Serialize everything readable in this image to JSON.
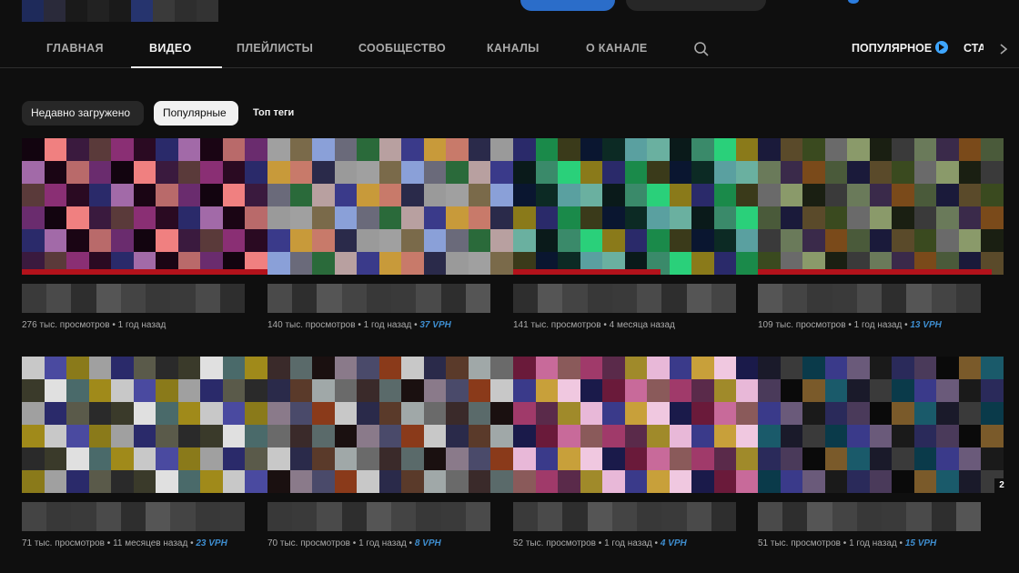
{
  "tabs": [
    {
      "label": "ГЛАВНАЯ",
      "active": false
    },
    {
      "label": "ВИДЕО",
      "active": true
    },
    {
      "label": "ПЛЕЙЛИСТЫ",
      "active": false
    },
    {
      "label": "СООБЩЕСТВО",
      "active": false
    },
    {
      "label": "КАНАЛЫ",
      "active": false
    },
    {
      "label": "О КАНАЛЕ",
      "active": false
    }
  ],
  "tabs_right": {
    "popular_label": "ПОПУЛЯРНОЕ",
    "cut_label": "СТА"
  },
  "chips": {
    "recent": "Недавно загружено",
    "popular": "Популярные",
    "top_tags": "Топ теги"
  },
  "colors": {
    "accent": "#3ea6ff",
    "vph": "#3e8ed0",
    "progress": "#b3121b",
    "subscribe": "#2b6dc9"
  },
  "videos": [
    {
      "views": "276 тыс. просмотров",
      "age": "1 год назад",
      "vph": "",
      "watched": 1.0,
      "palette": [
        "#12040f",
        "#1a0514",
        "#2a0a22",
        "#3a1a3e",
        "#6a2c6e",
        "#a26aa8",
        "#8a2f74",
        "#f08080",
        "#b96a6a",
        "#2a2a6a",
        "#5a3a3a"
      ]
    },
    {
      "views": "140 тыс. просмотров",
      "age": "1 год назад",
      "vph": "37 VPH",
      "watched": 0.0,
      "palette": [
        "#2a2a4a",
        "#3a3a8a",
        "#6a6a7a",
        "#a0a0a0",
        "#c87a6a",
        "#b8a0a0",
        "#8aa0d8",
        "#9a9a9a",
        "#c89a3a",
        "#2a6a3a",
        "#7a6a4a"
      ]
    },
    {
      "views": "141 тыс. просмотров",
      "age": "4 месяца назад",
      "vph": "",
      "watched": 0.6,
      "palette": [
        "#0a1a1a",
        "#0c2a24",
        "#1a8a4a",
        "#2ad07a",
        "#6ab0a0",
        "#0a1630",
        "#2a2a6a",
        "#3a8a6a",
        "#5aa0a0",
        "#3a3a1a",
        "#8a7a1a"
      ]
    },
    {
      "views": "109 тыс. просмотров",
      "age": "1 год назад",
      "vph": "13 VPH",
      "watched": 0.95,
      "palette": [
        "#1a1f12",
        "#3a4a1f",
        "#4a5a3a",
        "#6a7a5a",
        "#8a9a6a",
        "#5a4a2a",
        "#7a4a1a",
        "#3a3a3a",
        "#6a6a6a",
        "#1a1a3a",
        "#3a2a4a"
      ]
    },
    {
      "views": "71 тыс. просмотров",
      "age": "11 месяцев назад",
      "vph": "23 VPH",
      "watched": 0.0,
      "palette": [
        "#a0a0a0",
        "#c8c8c8",
        "#e0e0e0",
        "#5a5a4a",
        "#8a7a1a",
        "#a08a1a",
        "#3a3a2a",
        "#2a2a6a",
        "#4a4aa0",
        "#4a6a6a",
        "#2a2a2a"
      ]
    },
    {
      "views": "70 тыс. просмотров",
      "age": "1 год назад",
      "vph": "8 VPH",
      "watched": 0.0,
      "palette": [
        "#5a6a6a",
        "#a0a8a8",
        "#c8c8c8",
        "#8a7a8a",
        "#3a2a2a",
        "#5a3a2a",
        "#8a3a1a",
        "#1a1010",
        "#6a6a6a",
        "#2a2a4a",
        "#4a4a6a"
      ]
    },
    {
      "views": "52 тыс. просмотров",
      "age": "1 год назад",
      "vph": "4 VPH",
      "watched": 0.0,
      "palette": [
        "#1a1a4a",
        "#3a3a8a",
        "#5a2a4a",
        "#c86a9a",
        "#f0c8e0",
        "#e8b8d8",
        "#a03a6a",
        "#6a1a3a",
        "#c8a03a",
        "#a08a2a",
        "#8a5a5a"
      ]
    },
    {
      "views": "51 тыс. просмотров",
      "age": "1 год назад",
      "vph": "15 VPH",
      "watched": 0.0,
      "palette": [
        "#0a0a0a",
        "#1a1a1a",
        "#0a3a4a",
        "#1a5a6a",
        "#4a3a5a",
        "#6a5a7a",
        "#3a3a3a",
        "#7a5a2a",
        "#2a2a5a",
        "#3a3a8a",
        "#1a1a2a"
      ]
    }
  ],
  "corner_badge": "2"
}
